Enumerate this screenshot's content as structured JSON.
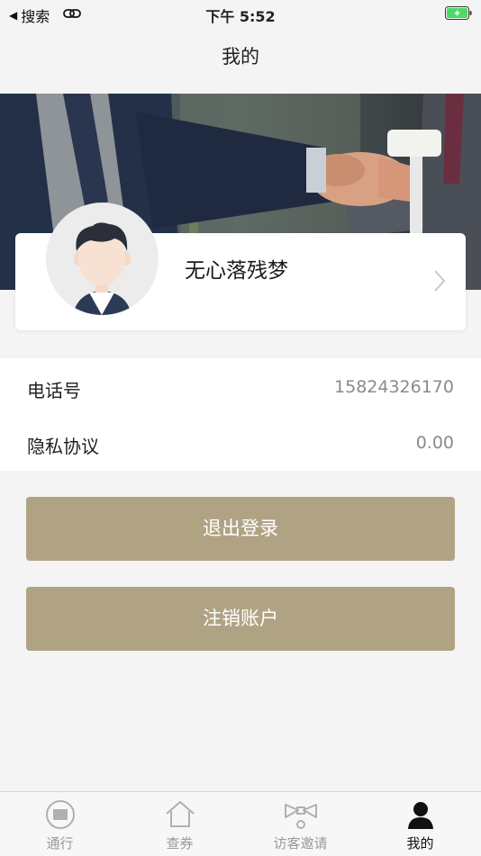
{
  "status_bar": {
    "back_label": "搜索",
    "time": "下午 5:52",
    "battery_color": "#4cd964"
  },
  "nav": {
    "title": "我的"
  },
  "profile": {
    "name": "无心落残梦",
    "avatar_icon": "user-avatar-icon",
    "chevron_icon": "chevron-right-icon"
  },
  "info": {
    "rows": [
      {
        "label": "电话号",
        "value": "15824326170"
      },
      {
        "label": "隐私协议",
        "value": "0.00"
      }
    ]
  },
  "buttons": {
    "logout_label": "退出登录",
    "delete_account_label": "注销账户",
    "color": "#b0a383"
  },
  "tabs": [
    {
      "label": "通行",
      "icon": "pass-icon",
      "active": false
    },
    {
      "label": "查券",
      "icon": "home-icon",
      "active": false
    },
    {
      "label": "访客邀请",
      "icon": "invite-bow-icon",
      "active": false
    },
    {
      "label": "我的",
      "icon": "person-icon",
      "active": true
    }
  ]
}
